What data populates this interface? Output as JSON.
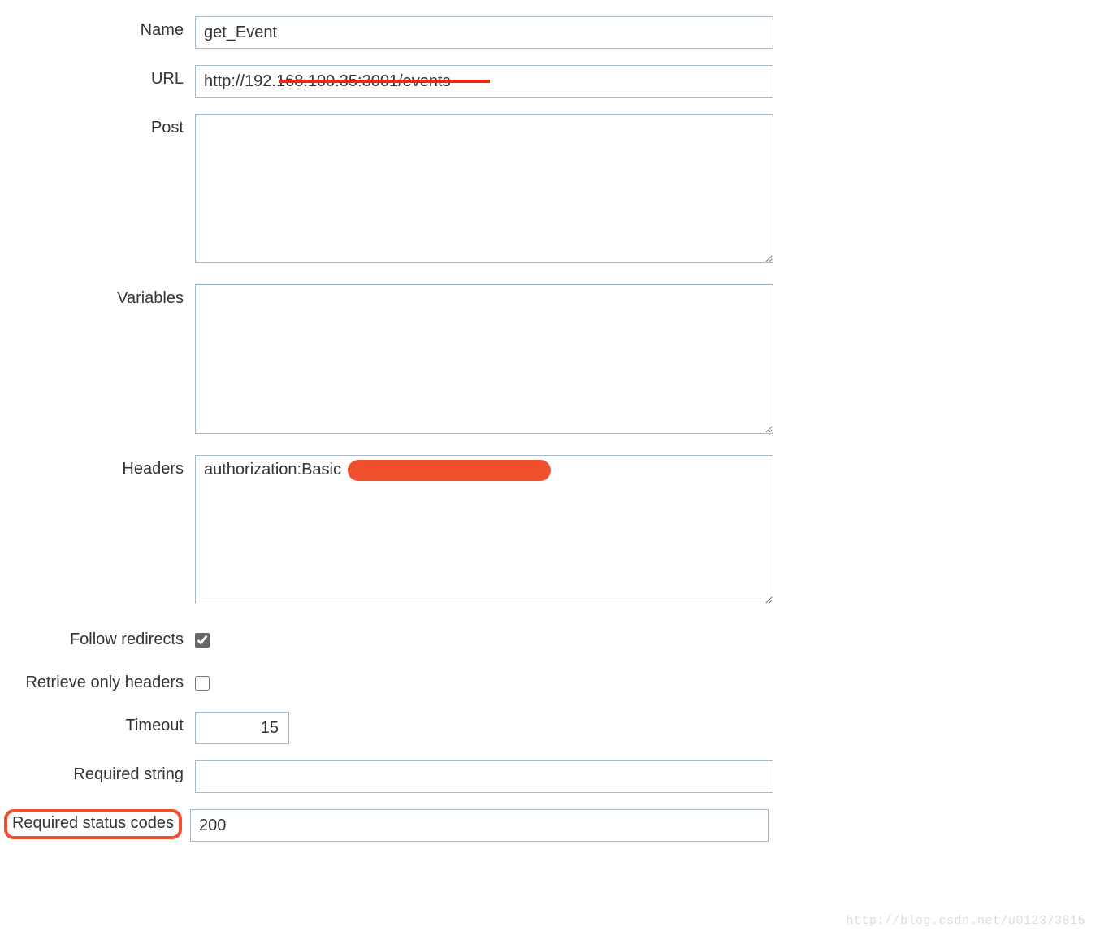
{
  "form": {
    "name": {
      "label": "Name",
      "value": "get_Event"
    },
    "url": {
      "label": "URL",
      "value": "http://192.168.100.35:3001/events"
    },
    "post": {
      "label": "Post",
      "value": ""
    },
    "variables": {
      "label": "Variables",
      "value": ""
    },
    "headers": {
      "label": "Headers",
      "value": "authorization:Basic"
    },
    "follow_redirects": {
      "label": "Follow redirects",
      "checked": true
    },
    "retrieve_only_headers": {
      "label": "Retrieve only headers",
      "checked": false
    },
    "timeout": {
      "label": "Timeout",
      "value": "15"
    },
    "required_string": {
      "label": "Required string",
      "value": ""
    },
    "required_status_codes": {
      "label": "Required status codes",
      "value": "200"
    }
  },
  "watermark": "http://blog.csdn.net/u012373815"
}
